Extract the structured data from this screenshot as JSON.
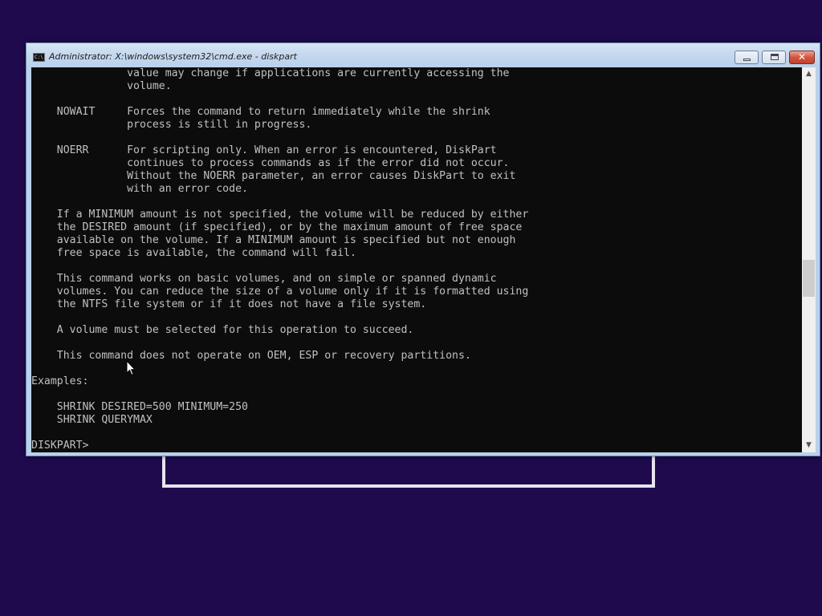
{
  "window": {
    "title": "Administrator: X:\\windows\\system32\\cmd.exe - diskpart",
    "minimize_label": "",
    "maximize_label": "",
    "close_label": "✕"
  },
  "console": {
    "lines": [
      "               value may change if applications are currently accessing the",
      "               volume.",
      "",
      "    NOWAIT     Forces the command to return immediately while the shrink",
      "               process is still in progress.",
      "",
      "    NOERR      For scripting only. When an error is encountered, DiskPart",
      "               continues to process commands as if the error did not occur.",
      "               Without the NOERR parameter, an error causes DiskPart to exit",
      "               with an error code.",
      "",
      "    If a MINIMUM amount is not specified, the volume will be reduced by either",
      "    the DESIRED amount (if specified), or by the maximum amount of free space",
      "    available on the volume. If a MINIMUM amount is specified but not enough",
      "    free space is available, the command will fail.",
      "",
      "    This command works on basic volumes, and on simple or spanned dynamic",
      "    volumes. You can reduce the size of a volume only if it is formatted using",
      "    the NTFS file system or if it does not have a file system.",
      "",
      "    A volume must be selected for this operation to succeed.",
      "",
      "    This command does not operate on OEM, ESP or recovery partitions.",
      "",
      "Examples:",
      "",
      "    SHRINK DESIRED=500 MINIMUM=250",
      "    SHRINK QUERYMAX",
      "",
      "DISKPART>"
    ]
  },
  "scrollbar": {
    "up_arrow": "▲",
    "down_arrow": "▼"
  },
  "icons": {
    "app": "cmd-console-icon",
    "minimize": "minimize-icon",
    "maximize": "maximize-icon",
    "close": "close-icon",
    "pointer": "mouse-pointer-icon"
  },
  "colors": {
    "desktop_background": "#1f0a4e",
    "console_background": "#0c0c0c",
    "console_foreground": "#c0c0c0",
    "titlebar": "#b9d1ea",
    "close_button": "#c2412b"
  }
}
